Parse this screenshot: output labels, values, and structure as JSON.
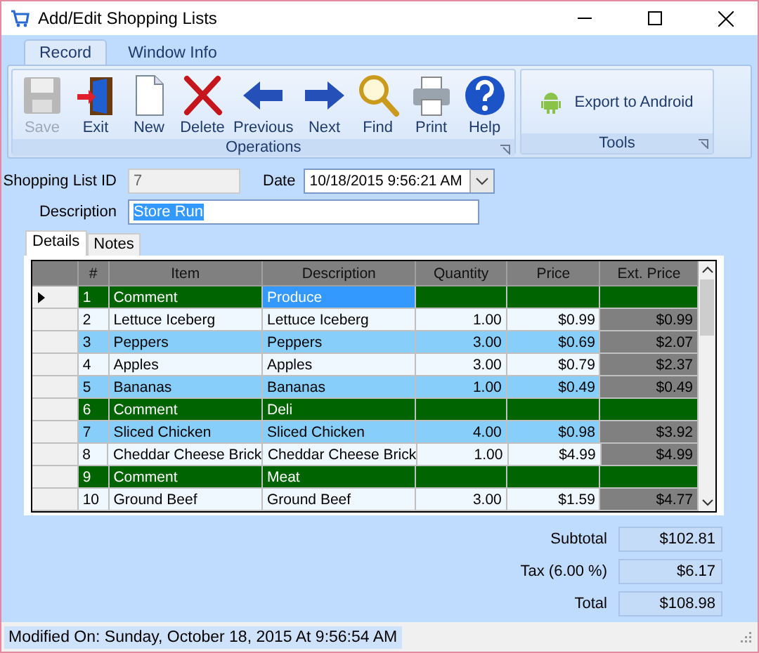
{
  "window": {
    "title": "Add/Edit Shopping Lists"
  },
  "ribbon_tabs": [
    {
      "label": "Record",
      "selected": true
    },
    {
      "label": "Window Info",
      "selected": false
    }
  ],
  "ribbon_groups": [
    {
      "label": "Operations",
      "buttons": [
        {
          "label": "Save",
          "disabled": true
        },
        {
          "label": "Exit",
          "disabled": false
        },
        {
          "label": "New",
          "disabled": false
        },
        {
          "label": "Delete",
          "disabled": false
        },
        {
          "label": "Previous",
          "disabled": false
        },
        {
          "label": "Next",
          "disabled": false
        },
        {
          "label": "Find",
          "disabled": false
        },
        {
          "label": "Print",
          "disabled": false
        },
        {
          "label": "Help",
          "disabled": false
        }
      ]
    },
    {
      "label": "Tools",
      "buttons": [
        {
          "label": "Export to Android",
          "disabled": false
        }
      ]
    }
  ],
  "form": {
    "shopping_list_id": {
      "label": "Shopping List ID",
      "value": "7",
      "disabled": true
    },
    "date": {
      "label": "Date",
      "value": "10/18/2015 9:56:21 AM"
    },
    "description": {
      "label": "Description",
      "value": "Store Run"
    }
  },
  "detail_tabs": [
    {
      "label": "Details",
      "selected": true
    },
    {
      "label": "Notes",
      "selected": false
    }
  ],
  "table": {
    "columns": [
      "#",
      "Item",
      "Description",
      "Quantity",
      "Price",
      "Ext. Price"
    ],
    "rows": [
      {
        "kind": "comment",
        "selected": true,
        "cells": [
          "1",
          "Comment",
          "Produce",
          "",
          "",
          ""
        ]
      },
      {
        "kind": "item",
        "selected": false,
        "cells": [
          "2",
          "Lettuce Iceberg",
          "Lettuce Iceberg",
          "1.00",
          "$0.99",
          "$0.99"
        ]
      },
      {
        "kind": "item",
        "selected": false,
        "cells": [
          "3",
          "Peppers",
          "Peppers",
          "3.00",
          "$0.69",
          "$2.07"
        ]
      },
      {
        "kind": "item",
        "selected": false,
        "cells": [
          "4",
          "Apples",
          "Apples",
          "3.00",
          "$0.79",
          "$2.37"
        ]
      },
      {
        "kind": "item",
        "selected": false,
        "cells": [
          "5",
          "Bananas",
          "Bananas",
          "1.00",
          "$0.49",
          "$0.49"
        ]
      },
      {
        "kind": "comment",
        "selected": false,
        "cells": [
          "6",
          "Comment",
          "Deli",
          "",
          "",
          ""
        ]
      },
      {
        "kind": "item",
        "selected": false,
        "cells": [
          "7",
          "Sliced Chicken",
          "Sliced Chicken",
          "4.00",
          "$0.98",
          "$3.92"
        ]
      },
      {
        "kind": "item",
        "selected": false,
        "cells": [
          "8",
          "Cheddar Cheese Brick",
          "Cheddar Cheese Brick",
          "1.00",
          "$4.99",
          "$4.99"
        ]
      },
      {
        "kind": "comment",
        "selected": false,
        "cells": [
          "9",
          "Comment",
          "Meat",
          "",
          "",
          ""
        ]
      },
      {
        "kind": "item",
        "selected": false,
        "cells": [
          "10",
          "Ground Beef",
          "Ground Beef",
          "3.00",
          "$1.59",
          "$4.77"
        ]
      }
    ]
  },
  "totals": [
    {
      "label": "Subtotal",
      "value": "$102.81"
    },
    {
      "label": "Tax (6.00 %)",
      "value": "$6.17"
    },
    {
      "label": "Total",
      "value": "$108.98"
    }
  ],
  "status_bar": "Modified On: Sunday, October 18, 2015 At 9:56:54 AM"
}
